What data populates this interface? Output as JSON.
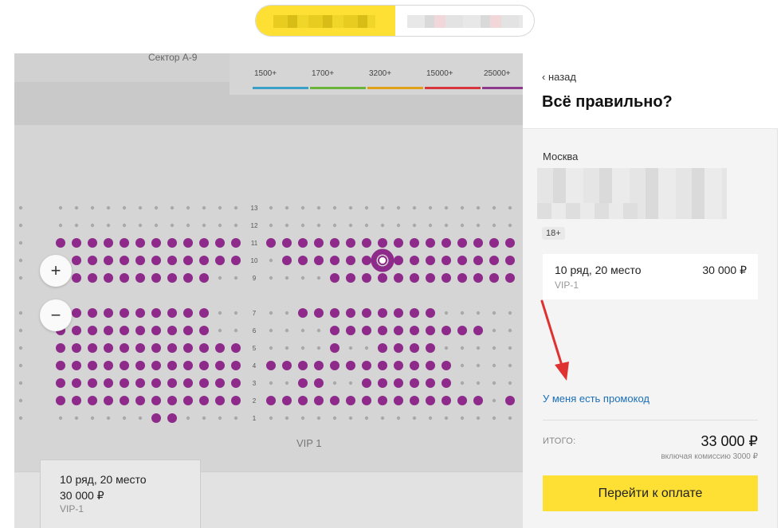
{
  "top_toggle": {
    "left_label": "",
    "right_label": ""
  },
  "map": {
    "sector_label": "Сектор А-9",
    "price_legend": [
      {
        "label": "1500+",
        "color": "#3aa0c8"
      },
      {
        "label": "1700+",
        "color": "#6cb33a"
      },
      {
        "label": "3200+",
        "color": "#e0a018"
      },
      {
        "label": "15000+",
        "color": "#d7363c"
      },
      {
        "label": "25000+",
        "color": "#8d3a8d"
      }
    ],
    "row_numbers": [
      "13",
      "12",
      "11",
      "10",
      "9",
      "7",
      "6",
      "5",
      "4",
      "3",
      "2",
      "1"
    ],
    "zoom_in": "+",
    "zoom_out": "−",
    "section_label": "VIP 1",
    "seat_color": "#8d2a8a",
    "ticket": {
      "row_seat": "10 ряд, 20 место",
      "price": "30 000 ₽",
      "category": "VIP-1"
    }
  },
  "panel": {
    "back_label": "назад",
    "title": "Всё правильно?",
    "city": "Москва",
    "age_rating": "18+",
    "seat": {
      "row_seat": "10 ряд, 20 место",
      "price": "30 000 ₽",
      "category": "VIP-1"
    },
    "promo_link": "У меня есть промокод",
    "total_label": "ИТОГО:",
    "total_value": "33 000 ₽",
    "total_note": "включая комиссию 3000 ₽",
    "pay_button": "Перейти к оплате",
    "accent_color": "#fde033"
  }
}
